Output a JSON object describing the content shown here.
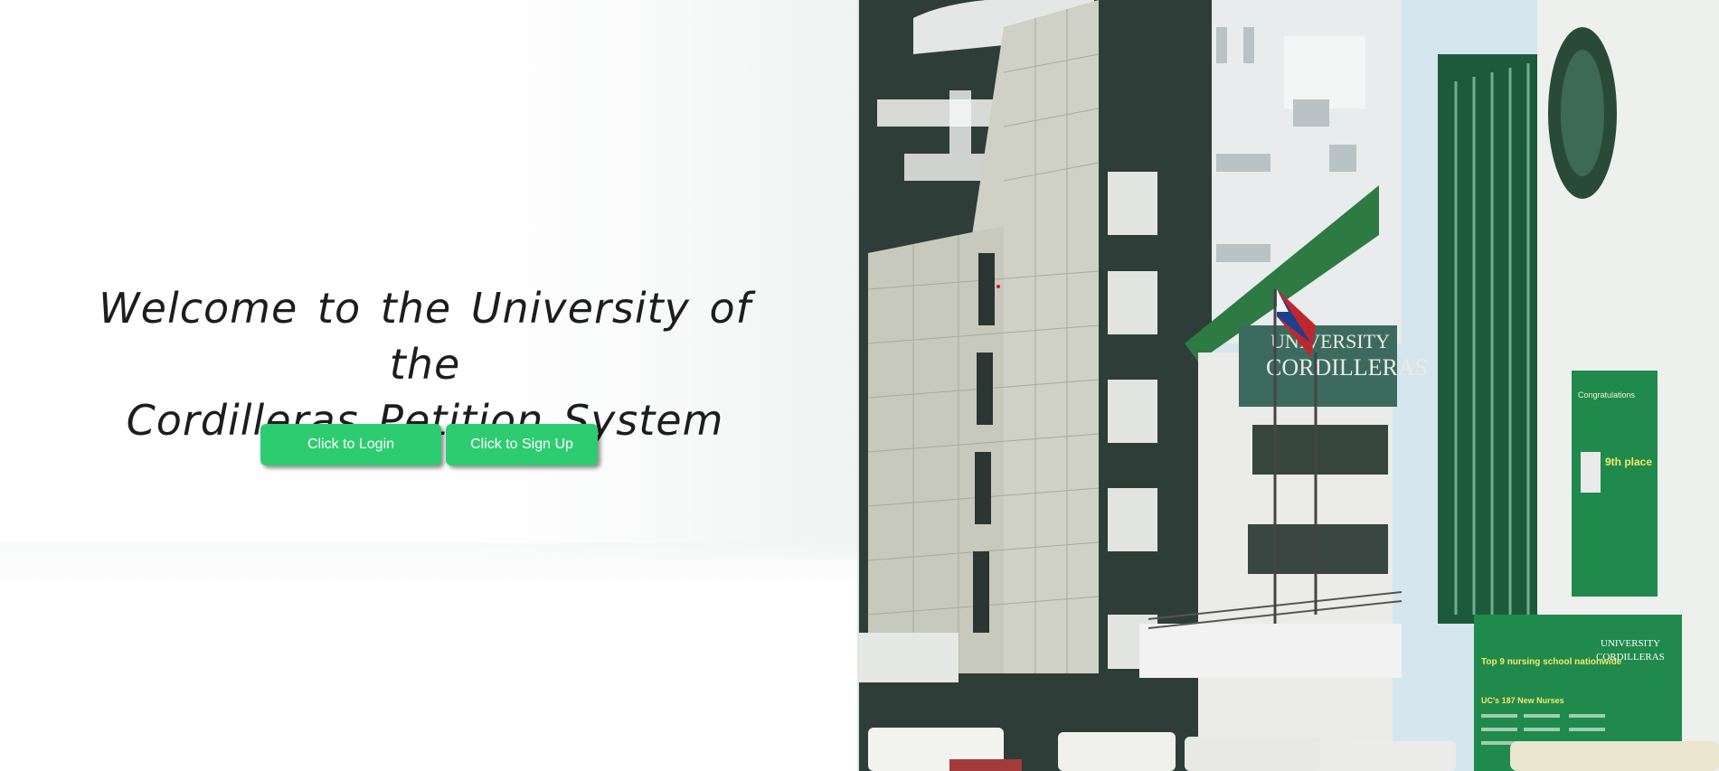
{
  "welcome": {
    "line1": "Welcome to the University of the",
    "line2": "Cordilleras Petition System"
  },
  "buttons": {
    "login_label": "Click to Login",
    "signup_label": "Click to Sign Up"
  },
  "colors": {
    "button_green": "#2ecc71",
    "heading_text": "#1d1d1d",
    "building_dark_green": "#2f3d38",
    "banner_green": "#1f8a4c"
  },
  "campus_photo": {
    "sign_line1": "UNIVERSITY",
    "sign_line2": "CORDILLERAS",
    "banner_top_line1": "Congratulations",
    "banner_top_place": "9th place",
    "banner_bottom_line1": "Top 9 nursing school nationwide",
    "banner_bottom_line2": "UC's 187 New Nurses",
    "banner_bottom_logo_line1": "UNIVERSITY",
    "banner_bottom_logo_line2": "CORDILLERAS"
  }
}
